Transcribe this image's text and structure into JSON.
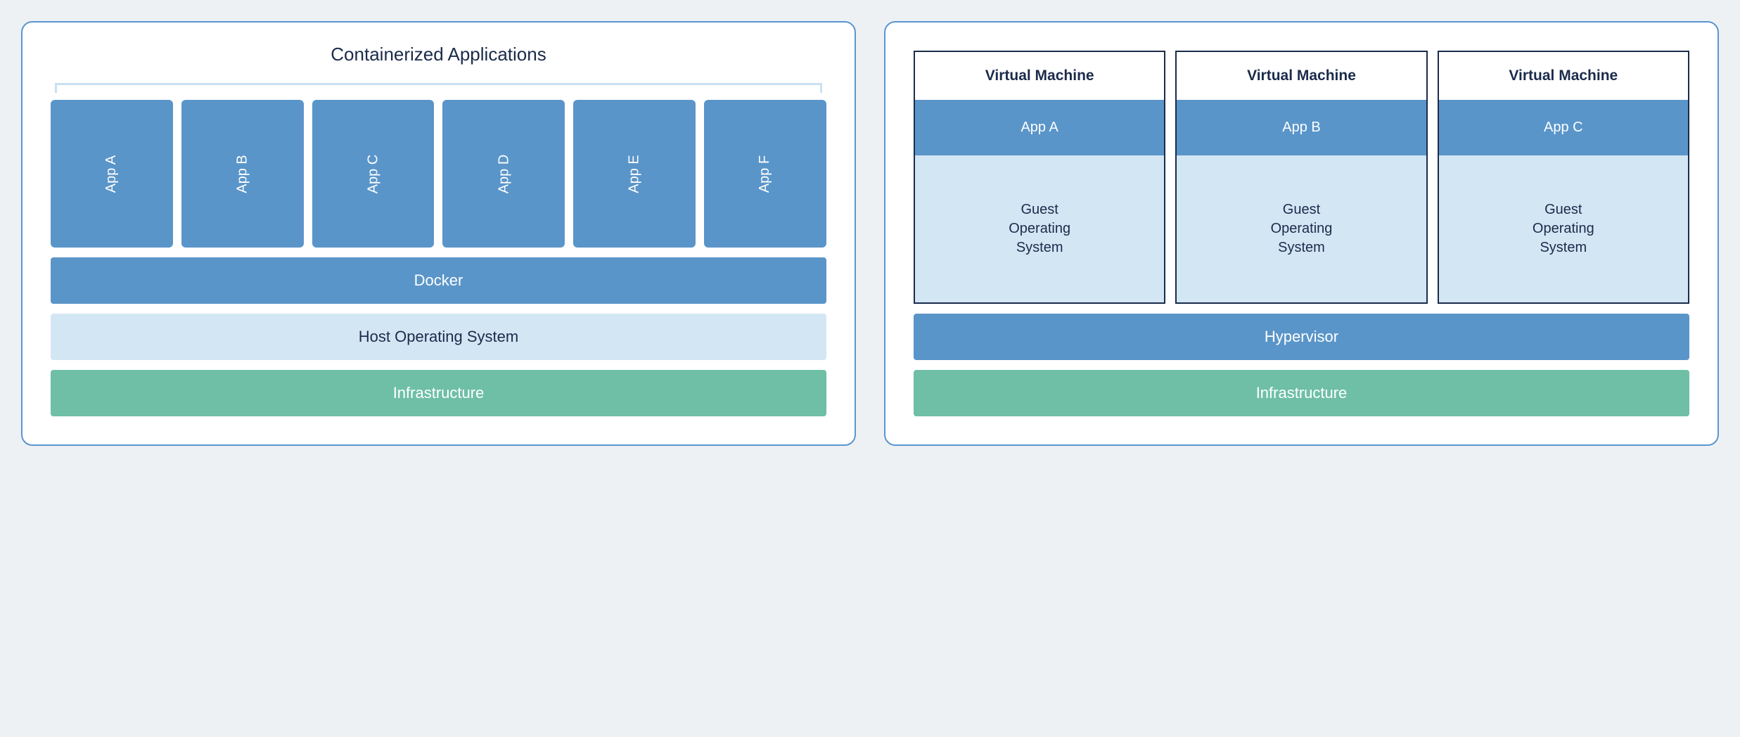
{
  "container_panel": {
    "title": "Containerized Applications",
    "apps": [
      "App A",
      "App B",
      "App C",
      "App D",
      "App E",
      "App F"
    ],
    "layers": {
      "runtime": "Docker",
      "host_os": "Host Operating System",
      "infra": "Infrastructure"
    }
  },
  "vm_panel": {
    "vms": [
      {
        "title": "Virtual Machine",
        "app": "App A",
        "guest": "Guest\nOperating\nSystem"
      },
      {
        "title": "Virtual Machine",
        "app": "App B",
        "guest": "Guest\nOperating\nSystem"
      },
      {
        "title": "Virtual Machine",
        "app": "App C",
        "guest": "Guest\nOperating\nSystem"
      }
    ],
    "layers": {
      "hypervisor": "Hypervisor",
      "infra": "Infrastructure"
    }
  }
}
